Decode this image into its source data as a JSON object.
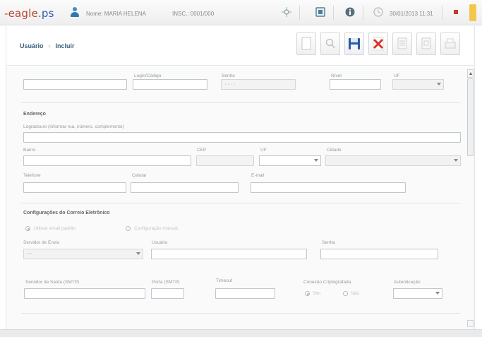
{
  "topbar": {
    "logo_prefix": "-eagle.",
    "logo_suffix": "ps",
    "user_name": "Nome: MARIA HELENA",
    "company": "INSC.: 0001/000",
    "datetime": "30/01/2013 11:31"
  },
  "breadcrumb": {
    "section": "Usuário",
    "page": "Incluir"
  },
  "form": {
    "row1": {
      "field1_label": "",
      "field2_label": "Login/Código",
      "field3_label": "Senha",
      "field3_value": "· · · ·",
      "field4_label": "Nível",
      "field5_label": "UF"
    },
    "address": {
      "title": "Endereço",
      "street_label": "Logradouro (informar rua, número, complemento)",
      "bairro_label": "Bairro",
      "cep_label": "CEP",
      "uf_label": "UF",
      "cidade_label": "Cidade",
      "telefone_label": "Telefone",
      "celular_label": "Celular",
      "email_label": "E-mail"
    },
    "email_config": {
      "title": "Configurações do Correio Eletrônico",
      "radio1_label": "Utilizar email padrão",
      "radio2_label": "Configuração manual",
      "servidor_label": "Servidor de Envio",
      "servidor_value": "---",
      "usuario_label": "Usuário",
      "senha_label": "Senha",
      "smtp_label": "Servidor de Saída (SMTP)",
      "porta_label": "Porta (SMTP)",
      "timeout_label": "Timeout",
      "ssl_label": "Conexão Criptografada",
      "ssl_yes": "Sim",
      "ssl_no": "Não",
      "auth_label": "Autenticação"
    }
  },
  "colors": {
    "logo_red": "#b7442f",
    "logo_blue": "#2d5fb3",
    "delete_red": "#d8332a",
    "save_blue": "#2c5aa0"
  },
  "icons": [
    "user-icon",
    "network-icon",
    "calendar-icon",
    "info-icon",
    "clock-icon",
    "flag-icon",
    "new-document-icon",
    "search-icon",
    "save-icon",
    "delete-icon",
    "edit-icon",
    "copy-icon",
    "print-icon"
  ]
}
